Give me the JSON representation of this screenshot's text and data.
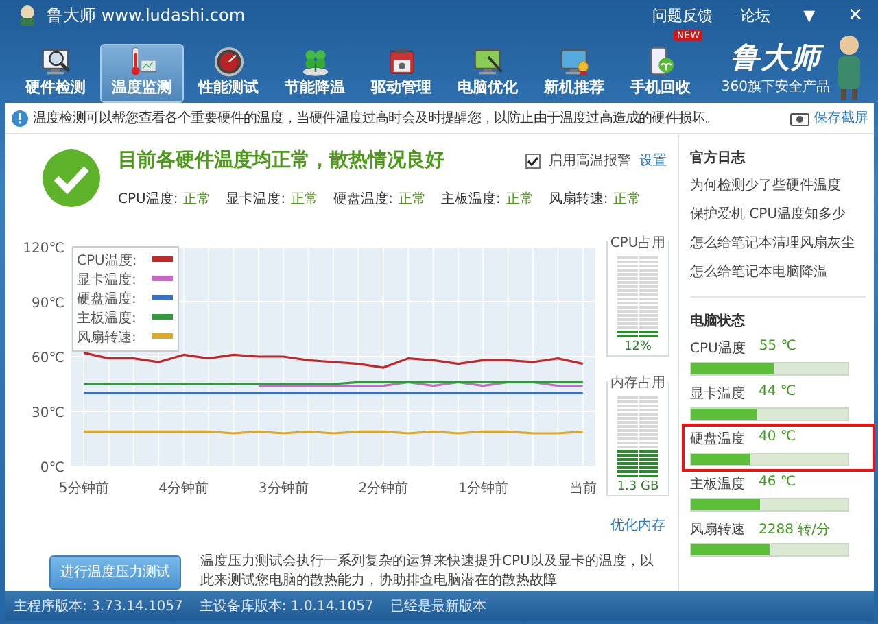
{
  "window": {
    "title": "鲁大师 www.ludashi.com",
    "links": [
      "问题反馈",
      "论坛"
    ],
    "menu_glyph": "▼",
    "close_glyph": "✕"
  },
  "toolbar": [
    {
      "label": "硬件检测",
      "selected": false
    },
    {
      "label": "温度监测",
      "selected": true
    },
    {
      "label": "性能测试",
      "selected": false
    },
    {
      "label": "节能降温",
      "selected": false
    },
    {
      "label": "驱动管理",
      "selected": false
    },
    {
      "label": "电脑优化",
      "selected": false
    },
    {
      "label": "新机推荐",
      "selected": false
    },
    {
      "label": "手机回收",
      "selected": false,
      "badge": "NEW"
    }
  ],
  "logo": {
    "name": "鲁大师",
    "slogan": "360旗下安全产品"
  },
  "info_bar": {
    "text": "温度检测可以帮您查看各个重要硬件的温度，当硬件温度过高时会及时提醒您，以防止由于温度过高造成的硬件损坏。",
    "action": "保存截屏"
  },
  "summary": {
    "headline": "目前各硬件温度均正常，散热情况良好",
    "alarm": {
      "label": "启用高温报警",
      "checked": true
    },
    "settings_link": "设置",
    "statuses": [
      {
        "label": "CPU温度:",
        "value": "正常"
      },
      {
        "label": "显卡温度:",
        "value": "正常"
      },
      {
        "label": "硬盘温度:",
        "value": "正常"
      },
      {
        "label": "主板温度:",
        "value": "正常"
      },
      {
        "label": "风扇转速:",
        "value": "正常"
      }
    ]
  },
  "chart_data": {
    "type": "line",
    "grid": true,
    "legend": true,
    "categories": [
      "5分钟前",
      null,
      null,
      null,
      "4分钟前",
      null,
      null,
      null,
      "3分钟前",
      null,
      null,
      null,
      "2分钟前",
      null,
      null,
      null,
      "1分钟前",
      null,
      null,
      null,
      "当前"
    ],
    "ylim": [
      0,
      120
    ],
    "yticks": [
      {
        "value": 0,
        "label": "0℃"
      },
      {
        "value": 30,
        "label": "30℃"
      },
      {
        "value": 60,
        "label": "60℃"
      },
      {
        "value": 90,
        "label": "90℃"
      },
      {
        "value": 120,
        "label": "120℃"
      }
    ],
    "series": [
      {
        "name": "CPU温度:",
        "color": "#c0282a",
        "values": [
          62,
          59,
          59,
          57,
          61,
          59,
          61,
          60,
          60,
          58,
          57,
          56,
          54,
          59,
          58,
          56,
          58,
          58,
          57,
          59,
          56
        ]
      },
      {
        "name": "显卡温度:",
        "color": "#c768c8",
        "values": [
          null,
          null,
          null,
          null,
          null,
          null,
          null,
          44,
          44,
          44,
          44,
          44,
          44,
          46,
          44,
          46,
          44,
          46,
          46,
          44,
          44
        ]
      },
      {
        "name": "硬盘温度:",
        "color": "#3a6fc4",
        "values": [
          40,
          40,
          40,
          40,
          40,
          40,
          40,
          40,
          40,
          40,
          40,
          40,
          40,
          40,
          40,
          40,
          40,
          40,
          40,
          40,
          40
        ]
      },
      {
        "name": "主板温度:",
        "color": "#2e9a3c",
        "values": [
          45,
          45,
          45,
          45,
          45,
          45,
          45,
          45,
          45,
          45,
          45,
          46,
          46,
          46,
          46,
          46,
          46,
          46,
          46,
          46,
          46
        ]
      },
      {
        "name": "风扇转速:",
        "color": "#d9a92a",
        "values": [
          19,
          19,
          19,
          19,
          19,
          19,
          18,
          19,
          18,
          19,
          18,
          19,
          19,
          18,
          19,
          18,
          19,
          19,
          18,
          18,
          19
        ]
      }
    ]
  },
  "gauges": [
    {
      "title": "CPU占用",
      "reading": "12%",
      "level": 0.12
    },
    {
      "title": "内存占用",
      "reading": "1.3 GB",
      "level": 0.35
    }
  ],
  "optimize_link": "优化内存",
  "stress_test": {
    "button": "进行温度压力测试",
    "description": "温度压力测试会执行一系列复杂的运算来快速提升CPU以及显卡的温度，以此来测试您电脑的散热能力，协助排查电脑潜在的散热故障"
  },
  "sidebar": {
    "news_title": "官方日志",
    "news": [
      "为何检测少了些硬件温度",
      "保护爱机 CPU温度知多少",
      "怎么给笔记本清理风扇灰尘",
      "怎么给笔记本电脑降温"
    ],
    "status_title": "电脑状态",
    "status": [
      {
        "label": "CPU温度",
        "value": "55 ℃",
        "level": 0.53,
        "highlighted": false
      },
      {
        "label": "显卡温度",
        "value": "44 ℃",
        "level": 0.42,
        "highlighted": false
      },
      {
        "label": "硬盘温度",
        "value": "40 ℃",
        "level": 0.38,
        "highlighted": true
      },
      {
        "label": "主板温度",
        "value": "46 ℃",
        "level": 0.44,
        "highlighted": false
      },
      {
        "label": "风扇转速",
        "value": "2288 转/分",
        "level": 0.5,
        "highlighted": false
      }
    ]
  },
  "status_bar": [
    "主程序版本: 3.73.14.1057",
    "主设备库版本: 1.0.14.1057",
    "已经是最新版本"
  ]
}
